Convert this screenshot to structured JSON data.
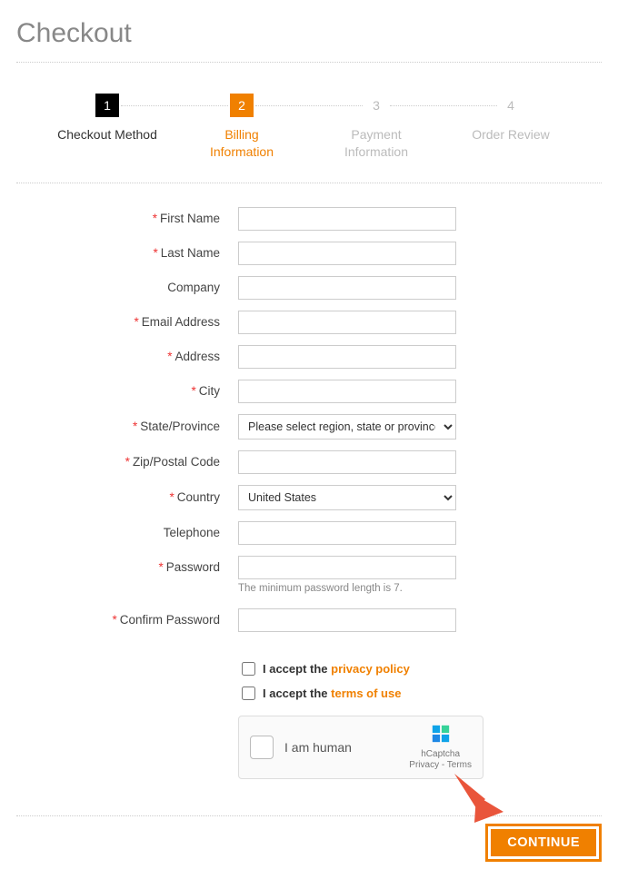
{
  "page": {
    "title": "Checkout"
  },
  "steps": [
    {
      "num": "1",
      "label": "Checkout Method",
      "state": "done"
    },
    {
      "num": "2",
      "label": "Billing\nInformation",
      "state": "active"
    },
    {
      "num": "3",
      "label": "Payment\nInformation",
      "state": ""
    },
    {
      "num": "4",
      "label": "Order Review",
      "state": ""
    }
  ],
  "fields": {
    "first_name": {
      "label": "First Name",
      "required": true,
      "value": ""
    },
    "last_name": {
      "label": "Last Name",
      "required": true,
      "value": ""
    },
    "company": {
      "label": "Company",
      "required": false,
      "value": ""
    },
    "email": {
      "label": "Email Address",
      "required": true,
      "value": ""
    },
    "address": {
      "label": "Address",
      "required": true,
      "value": ""
    },
    "city": {
      "label": "City",
      "required": true,
      "value": ""
    },
    "state": {
      "label": "State/Province",
      "required": true,
      "selected": "Please select region, state or province"
    },
    "zip": {
      "label": "Zip/Postal Code",
      "required": true,
      "value": ""
    },
    "country": {
      "label": "Country",
      "required": true,
      "selected": "United States"
    },
    "telephone": {
      "label": "Telephone",
      "required": false,
      "value": ""
    },
    "password": {
      "label": "Password",
      "required": true,
      "value": "",
      "hint": "The minimum password length is 7."
    },
    "confirm_password": {
      "label": "Confirm Password",
      "required": true,
      "value": ""
    }
  },
  "consents": {
    "privacy": {
      "prefix": "I accept the ",
      "link": "privacy policy",
      "checked": false
    },
    "terms": {
      "prefix": "I accept the ",
      "link": "terms of use",
      "checked": false
    }
  },
  "captcha": {
    "text": "I am human",
    "brand": "hCaptcha",
    "links": "Privacy - Terms"
  },
  "actions": {
    "continue": "CONTINUE"
  },
  "colors": {
    "accent": "#f08000",
    "required": "#e33"
  }
}
